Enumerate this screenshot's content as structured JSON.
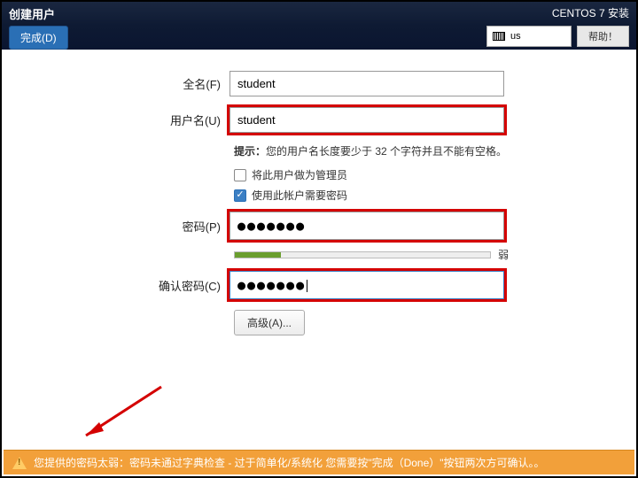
{
  "header": {
    "title": "创建用户",
    "done_label": "完成(D)",
    "install_title": "CENTOS 7 安装",
    "keyboard_layout": "us",
    "help_label": "帮助！"
  },
  "form": {
    "fullname_label": "全名(F)",
    "fullname_value": "student",
    "username_label": "用户名(U)",
    "username_value": "student",
    "hint_prefix": "提示：",
    "hint_text": "您的用户名长度要少于 32 个字符并且不能有空格。",
    "admin_checkbox_label": "将此用户做为管理员",
    "admin_checked": false,
    "require_pw_label": "使用此帐户需要密码",
    "require_pw_checked": true,
    "password_label": "密码(P)",
    "password_mask": "●●●●●●●",
    "strength_label": "弱",
    "confirm_label": "确认密码(C)",
    "confirm_mask": "●●●●●●●",
    "advanced_label": "高级(A)..."
  },
  "warning": {
    "text": "您提供的密码太弱：密码未通过字典检查 - 过于简单化/系统化 您需要按\"完成（Done）\"按钮两次方可确认。。"
  }
}
